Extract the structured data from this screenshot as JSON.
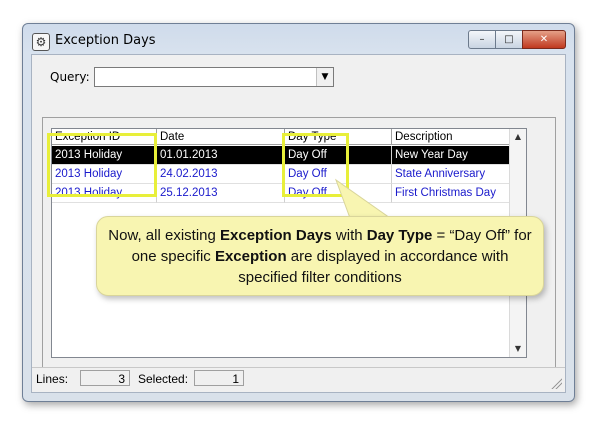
{
  "window": {
    "title": "Exception Days",
    "icon": "gear-icon",
    "buttons": {
      "minimize": "–",
      "maximize": "□",
      "close": "✕"
    }
  },
  "query": {
    "label": "Query:",
    "value": ""
  },
  "table": {
    "columns": [
      "Exception ID",
      "Date",
      "Day Type",
      "Description"
    ],
    "rows": [
      [
        "2013 Holiday",
        "01.01.2013",
        "Day Off",
        "New Year Day"
      ],
      [
        "2013 Holiday",
        "24.02.2013",
        "Day Off",
        "State Anniversary"
      ],
      [
        "2013 Holiday",
        "25.12.2013",
        "Day Off",
        "First Christmas Day"
      ]
    ],
    "selected_row": 0
  },
  "callout": {
    "parts": [
      {
        "text": "Now, all existing ",
        "bold": false
      },
      {
        "text": "Exception Days",
        "bold": true
      },
      {
        "text": " with ",
        "bold": false
      },
      {
        "text": "Day Type",
        "bold": true
      },
      {
        "text": " = “Day Off” for one specific ",
        "bold": false
      },
      {
        "text": "Exception",
        "bold": true
      },
      {
        "text": " are displayed in accordance with specified filter conditions",
        "bold": false
      }
    ]
  },
  "status": {
    "lines_label": "Lines:",
    "lines_value": "3",
    "selected_label": "Selected:",
    "selected_value": "1"
  },
  "colors": {
    "row_text": "#1a1acc",
    "highlight": "#e8ef3a",
    "callout_bg": "#f8f5b1"
  }
}
